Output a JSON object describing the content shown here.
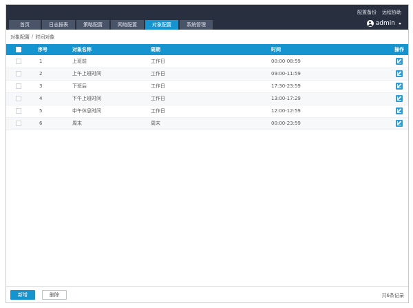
{
  "header": {
    "links": [
      "配置备份",
      "远程协助"
    ],
    "user": "admin"
  },
  "tabs": [
    {
      "label": "首页",
      "active": false
    },
    {
      "label": "日志报表",
      "active": false
    },
    {
      "label": "策略配置",
      "active": false
    },
    {
      "label": "网络配置",
      "active": false
    },
    {
      "label": "对象配置",
      "active": true
    },
    {
      "label": "系统管理",
      "active": false
    }
  ],
  "breadcrumb": {
    "parent": "对象配置",
    "separator": "/",
    "current": "时间对象"
  },
  "table": {
    "headers": {
      "no": "序号",
      "name": "对象名称",
      "period": "周期",
      "time": "时间",
      "op": "操作"
    },
    "rows": [
      {
        "no": "1",
        "name": "上班前",
        "period": "工作日",
        "time": "00:00-08:59"
      },
      {
        "no": "2",
        "name": "上午上班时间",
        "period": "工作日",
        "time": "09:00-11:59"
      },
      {
        "no": "3",
        "name": "下班后",
        "period": "工作日",
        "time": "17:30-23:59"
      },
      {
        "no": "4",
        "name": "下午上班时间",
        "period": "工作日",
        "time": "13:00-17:29"
      },
      {
        "no": "5",
        "name": "中午休息时间",
        "period": "工作日",
        "time": "12:00-12:59"
      },
      {
        "no": "6",
        "name": "周末",
        "period": "周末",
        "time": "00:00-23:59"
      }
    ]
  },
  "footer": {
    "new_label": "新增",
    "delete_label": "删除",
    "count_text": "共6条记录"
  },
  "colors": {
    "header_bg": "#283040",
    "accent": "#1594cf",
    "tab_bg": "#4a5468"
  }
}
